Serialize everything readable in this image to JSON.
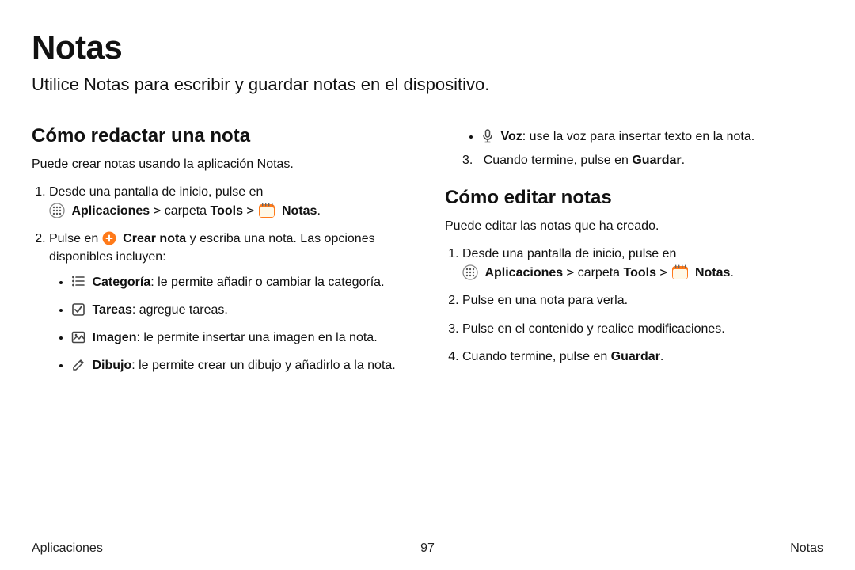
{
  "title": "Notas",
  "subtitle": "Utilice Notas para escribir y guardar notas en el dispositivo.",
  "section_compose": {
    "heading": "Cómo redactar una nota",
    "intro": "Puede crear notas usando la aplicación Notas.",
    "step1_a": "Desde una pantalla de inicio, pulse en",
    "step1_apps": "Aplicaciones",
    "step1_b": " carpeta ",
    "step1_tools": "Tools",
    "step1_notes": "Notas",
    "step2_a": "Pulse en ",
    "step2_create": "Crear nota",
    "step2_b": " y escriba una nota. Las opciones disponibles incluyen:",
    "opt_category_label": "Categoría",
    "opt_category_text": ": le permite añadir o cambiar la categoría.",
    "opt_tasks_label": "Tareas",
    "opt_tasks_text": ": agregue tareas.",
    "opt_image_label": "Imagen",
    "opt_image_text": ": le permite insertar una imagen en la nota.",
    "opt_drawing_label": "Dibujo",
    "opt_drawing_text": ": le permite crear un dibujo y añadirlo a la nota."
  },
  "section_right_top": {
    "voice_label": "Voz",
    "voice_text": ": use la voz para insertar texto en la nota.",
    "step3_a": "Cuando termine, pulse en ",
    "step3_save": "Guardar",
    "step3_num": "3."
  },
  "section_edit": {
    "heading": "Cómo editar notas",
    "intro": "Puede editar las notas que ha creado.",
    "step1_a": "Desde una pantalla de inicio, pulse en",
    "step1_apps": "Aplicaciones",
    "step1_b": " carpeta ",
    "step1_tools": "Tools",
    "step1_notes": "Notas",
    "step2": "Pulse en una nota para verla.",
    "step3": "Pulse en el contenido y realice modificaciones.",
    "step4_a": "Cuando termine, pulse en ",
    "step4_save": "Guardar"
  },
  "footer": {
    "left": "Aplicaciones",
    "page": "97",
    "right": "Notas"
  },
  "chevron": ">"
}
